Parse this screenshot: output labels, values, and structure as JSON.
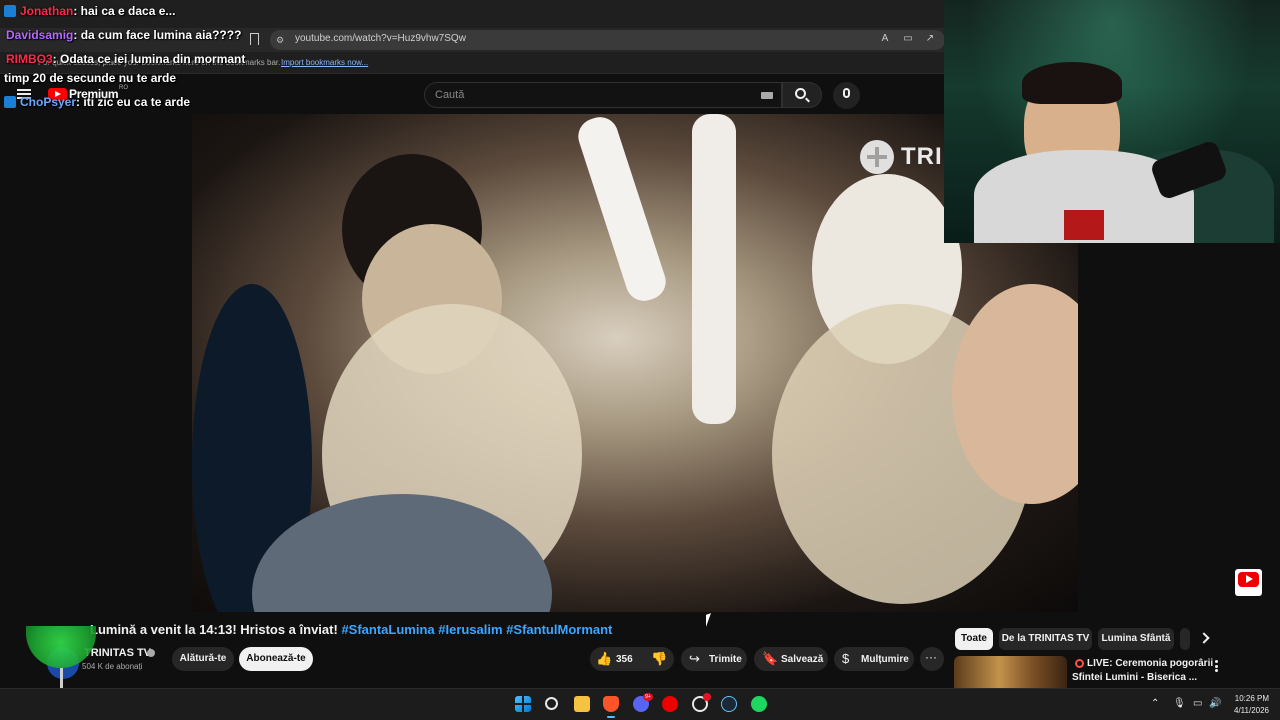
{
  "browser": {
    "url": "youtube.com/watch?v=Huz9vhw7SQw",
    "bookmarks_hint": "For quick access, place your bookmarks here on the bookmarks bar.",
    "bookmarks_link": "Import bookmarks now..."
  },
  "youtube": {
    "logo_text": "Premium",
    "country": "RO",
    "search_placeholder": "Caută"
  },
  "chat": [
    {
      "name": "Jonathan",
      "text": ": hai ca e daca e...",
      "color": "red",
      "badge": true
    },
    {
      "name": "Davidsamig",
      "text": ": da cum face lumina aia????",
      "color": "purple",
      "badge": false
    },
    {
      "name": "RIMBO3",
      "text": ": Odata ce iei lumina din mormant",
      "color": "red",
      "badge": false
    },
    {
      "name": "",
      "text": "timp 20 de secunde nu te arde",
      "color": "",
      "badge": false
    },
    {
      "name": "ChoPsyer",
      "text": ": iti zic eu ca te arde",
      "color": "blue",
      "badge": true
    }
  ],
  "video": {
    "watermark": "TRINITAS",
    "title_prefix": "Lumină a venit la 14:13! Hristos a înviat!",
    "tags": [
      "#SfantaLumina",
      "#Ierusalim",
      "#SfantulMormant"
    ]
  },
  "channel": {
    "name": "TRINITAS TV",
    "subscribers": "504 K de abonați",
    "join_label": "Alătură-te",
    "subscribe_label": "Abonează-te"
  },
  "actions": {
    "like_count": "356",
    "share_label": "Trimite",
    "save_label": "Salvează",
    "thanks_label": "Mulțumire"
  },
  "sidebar": {
    "chips": [
      "Toate",
      "De la TRINITAS TV",
      "Lumina Sfântă"
    ],
    "rec_line1": "LIVE: Ceremonia pogorârii",
    "rec_line2": "Sfintei Lumini - Biserica ..."
  },
  "taskbar": {
    "time": "10:26 PM",
    "date": "4/11/2026",
    "discord_badge": "9+"
  }
}
